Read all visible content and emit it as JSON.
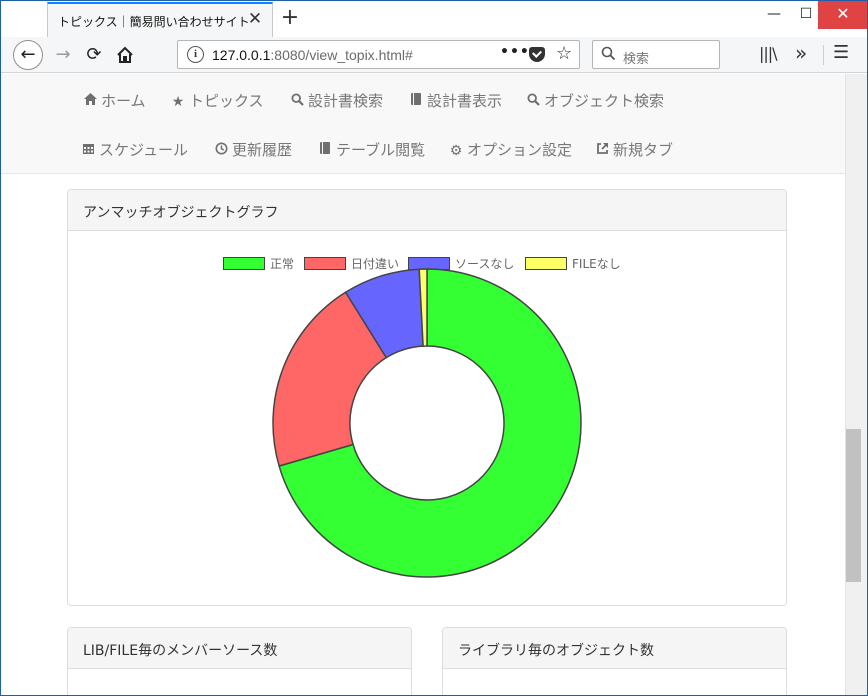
{
  "browser": {
    "tab_title": "トピックス｜簡易問い合わせサイト",
    "tab_close": "✕",
    "new_tab": "+",
    "win_min": "—",
    "win_max": "☐",
    "win_close": "✕",
    "url_host": "127.0.0.1",
    "url_rest": ":8080/view_topix.html#",
    "url_dots": "•••",
    "search_placeholder": "検索",
    "icons": [
      "back-arrow-icon",
      "forward-arrow-icon",
      "reload-icon",
      "home-icon",
      "info-icon",
      "pocket-icon",
      "star-icon",
      "search-icon",
      "library-icon",
      "overflow-icon",
      "hamburger-menu-icon"
    ]
  },
  "site_nav": {
    "items": [
      {
        "label": "ホーム",
        "icon": "home-icon"
      },
      {
        "label": "トピックス",
        "icon": "star-icon"
      },
      {
        "label": "設計書検索",
        "icon": "search-icon"
      },
      {
        "label": "設計書表示",
        "icon": "book-icon"
      },
      {
        "label": "オブジェクト検索",
        "icon": "search-icon"
      },
      {
        "label": "スケジュール",
        "icon": "calendar-icon"
      },
      {
        "label": "更新履歴",
        "icon": "clock-icon"
      },
      {
        "label": "テーブル閲覧",
        "icon": "book-icon"
      },
      {
        "label": "オプション設定",
        "icon": "gear-icon"
      },
      {
        "label": "新規タブ",
        "icon": "external-link-icon"
      }
    ]
  },
  "panels": {
    "unmatch": {
      "title": "アンマッチオブジェクトグラフ"
    },
    "lib_file": {
      "title": "LIB/FILE毎のメンバーソース数"
    },
    "library": {
      "title": "ライブラリ毎のオブジェクト数"
    }
  },
  "chart_data": {
    "type": "pie",
    "variant": "doughnut",
    "legend_position": "top",
    "series": [
      {
        "name": "正常",
        "value": 70,
        "color": "#33ff33"
      },
      {
        "name": "日付違い",
        "value": 20.5,
        "color": "#ff6666"
      },
      {
        "name": "ソースなし",
        "value": 8,
        "color": "#6666ff"
      },
      {
        "name": "FILEなし",
        "value": 0.8,
        "color": "#ffff66"
      }
    ],
    "border_color": "#444444"
  }
}
